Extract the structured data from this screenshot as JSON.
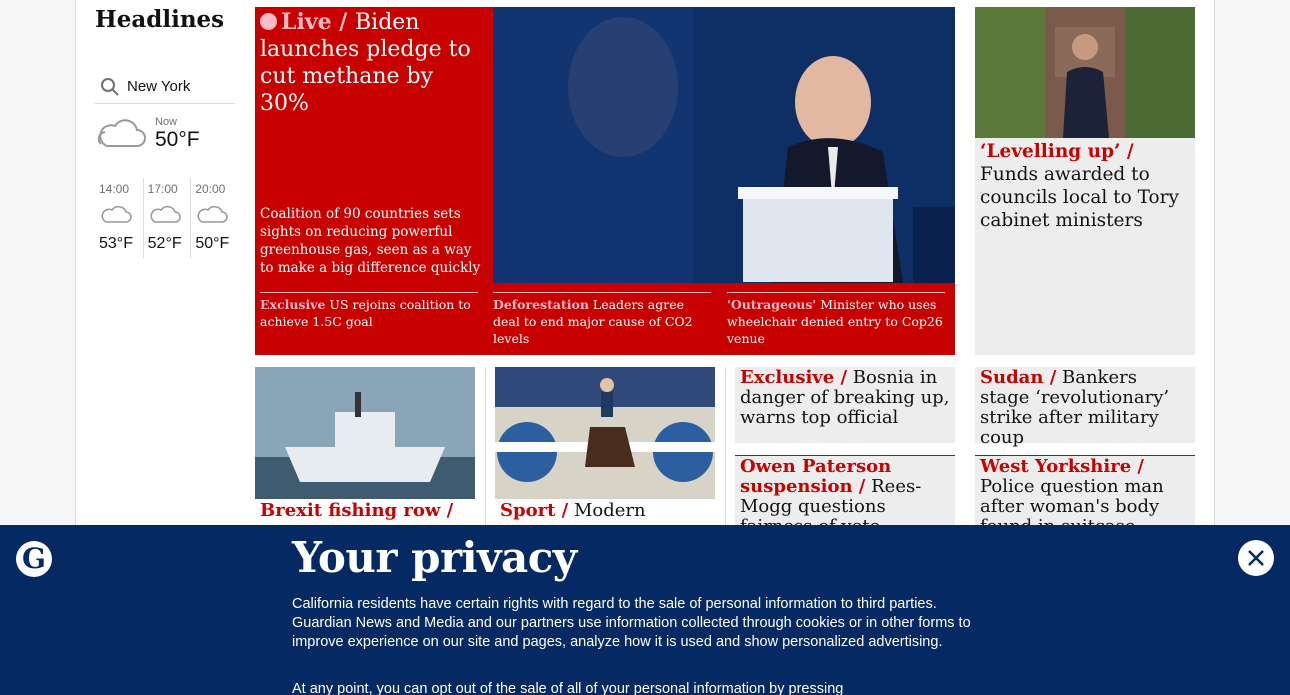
{
  "section": {
    "title": "Headlines"
  },
  "weather": {
    "location": "New York",
    "now_label": "Now",
    "now_temp": "50°F",
    "forecast": [
      {
        "time": "14:00",
        "temp": "53°F"
      },
      {
        "time": "17:00",
        "temp": "52°F"
      },
      {
        "time": "20:00",
        "temp": "50°F"
      }
    ]
  },
  "feature": {
    "kicker": "Live /",
    "headline": "Biden launches pledge to cut methane by 30%",
    "standfirst": "Coalition of 90 countries sets sights on reducing powerful greenhouse gas, seen as a way to make a big difference quickly",
    "sublinks": [
      {
        "kicker": "Exclusive",
        "text": "US rejoins coalition to achieve 1.5C goal"
      },
      {
        "kicker": "Deforestation",
        "text": "Leaders agree deal to end major cause of CO2 levels"
      },
      {
        "kicker": "'Outrageous'",
        "text": "Minister who uses wheelchair denied entry to Cop26 venue"
      }
    ]
  },
  "right_card": {
    "kicker": "‘Levelling up’ /",
    "headline": "Funds awarded to councils local to Tory cabinet ministers"
  },
  "row2": [
    {
      "kicker": "Brexit fishing row /",
      "headline": ""
    },
    {
      "kicker": "Sport /",
      "headline": "Modern"
    },
    {
      "kicker": "Exclusive /",
      "headline": "Bosnia in danger of breaking up, warns top official"
    },
    {
      "kicker": "Sudan /",
      "headline": "Bankers stage ‘revolutionary’ strike after military coup"
    },
    {
      "kicker": "Owen Paterson suspension /",
      "headline": "Rees-Mogg questions fairness of vote"
    },
    {
      "kicker": "West Yorkshire /",
      "headline": "Police question man after woman's body found in suitcase"
    }
  ],
  "privacy": {
    "title": "Your privacy",
    "text": "California residents have certain rights with regard to the sale of personal information to third parties. Guardian News and Media and our partners use information collected through cookies or in other forms to improve experience on our site and pages, analyze how it is used and show personalized advertising.",
    "text2": "At any point, you can opt out of the sale of all of your personal information by pressing"
  },
  "colors": {
    "brand_red": "#c70000",
    "guardian_blue": "#052962",
    "pink": "#ffbac8"
  },
  "icons": {
    "search": "search-icon",
    "cloud": "cloud-icon",
    "close": "close-icon",
    "logo": "guardian-logo"
  }
}
